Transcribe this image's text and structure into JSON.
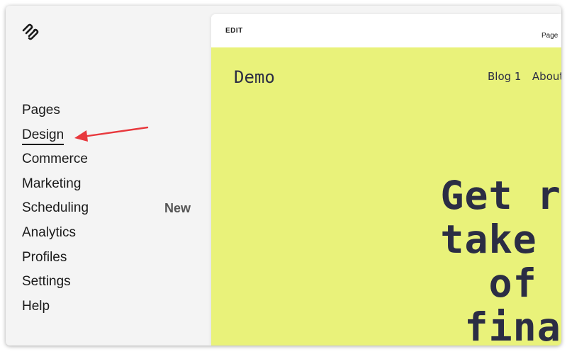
{
  "sidebar": {
    "logo_icon": "squarespace-logo-icon",
    "items": [
      {
        "label": "Pages"
      },
      {
        "label": "Design",
        "active": true
      },
      {
        "label": "Commerce"
      },
      {
        "label": "Marketing"
      },
      {
        "label": "Scheduling",
        "badge": "New"
      },
      {
        "label": "Analytics"
      },
      {
        "label": "Profiles"
      },
      {
        "label": "Settings"
      },
      {
        "label": "Help"
      }
    ]
  },
  "annotation": {
    "icon": "red-arrow-icon",
    "color": "#e8383d"
  },
  "preview": {
    "edit_label": "EDIT",
    "page_label": "Page",
    "site": {
      "title": "Demo",
      "nav": [
        "Blog 1",
        "About Us"
      ],
      "hero_lines": [
        "Get re",
        "take c",
        "of y",
        "finar"
      ],
      "background": "#e9f27a",
      "text_color": "#2b2d44"
    }
  }
}
